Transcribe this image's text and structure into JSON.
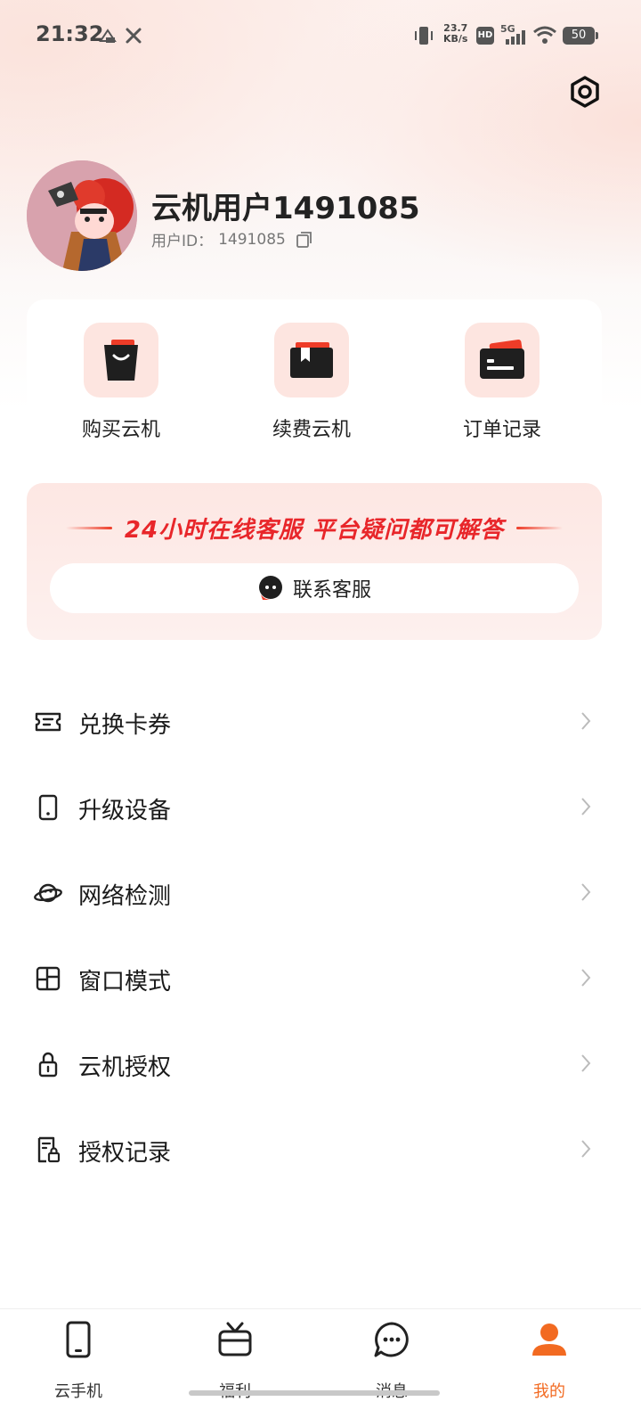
{
  "status_bar": {
    "time": "21:32",
    "net_speed_value": "23.7",
    "net_speed_unit": "KB/s",
    "hd_label": "HD",
    "network_type": "5G",
    "battery": "50"
  },
  "profile": {
    "name": "云机用户1491085",
    "id_label": "用户ID：",
    "id_value": "1491085"
  },
  "quick_actions": [
    {
      "label": "购买云机",
      "icon": "shopping-bag-icon"
    },
    {
      "label": "续费云机",
      "icon": "renew-box-icon"
    },
    {
      "label": "订单记录",
      "icon": "order-card-icon"
    }
  ],
  "service": {
    "title": "24小时在线客服 平台疑问都可解答",
    "button_label": "联系客服",
    "accent_color": "#e8262a"
  },
  "menu": [
    {
      "label": "兑换卡券",
      "icon": "ticket-icon"
    },
    {
      "label": "升级设备",
      "icon": "phone-icon"
    },
    {
      "label": "网络检测",
      "icon": "planet-icon"
    },
    {
      "label": "窗口模式",
      "icon": "window-layout-icon"
    },
    {
      "label": "云机授权",
      "icon": "lock-icon"
    },
    {
      "label": "授权记录",
      "icon": "document-lock-icon"
    }
  ],
  "bottom_nav": [
    {
      "label": "云手机",
      "icon": "phone-icon",
      "active": false
    },
    {
      "label": "福利",
      "icon": "gift-icon",
      "active": false
    },
    {
      "label": "消息",
      "icon": "chat-bubble-icon",
      "active": false
    },
    {
      "label": "我的",
      "icon": "user-icon",
      "active": true
    }
  ],
  "colors": {
    "accent": "#f26a21",
    "icon_bg": "#fde5e0"
  }
}
